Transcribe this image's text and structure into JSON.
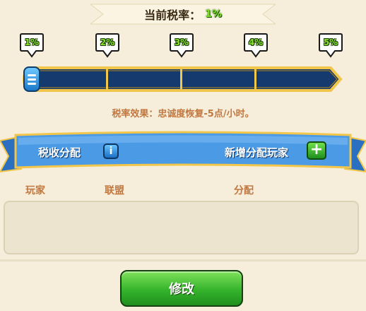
{
  "header": {
    "tax_label": "当前税率：",
    "tax_value": "1%"
  },
  "slider": {
    "levels": [
      "1%",
      "2%",
      "3%",
      "4%",
      "5%"
    ],
    "current_level": 1,
    "effect_text": "税率效果：忠诚度恢复-5点/小时。"
  },
  "distribution": {
    "title": "税收分配",
    "info_icon": "info-icon",
    "add_label": "新增分配玩家",
    "add_icon": "plus-icon",
    "columns": [
      "玩家",
      "联盟",
      "分配"
    ],
    "rows": []
  },
  "footer": {
    "modify_label": "修改"
  },
  "colors": {
    "background": "#f6eedb",
    "track": "#153a6e",
    "gold": "#f2c64a",
    "accent_text": "#c2773f",
    "banner": "#3f8fe0",
    "button_green": "#35b32c"
  }
}
